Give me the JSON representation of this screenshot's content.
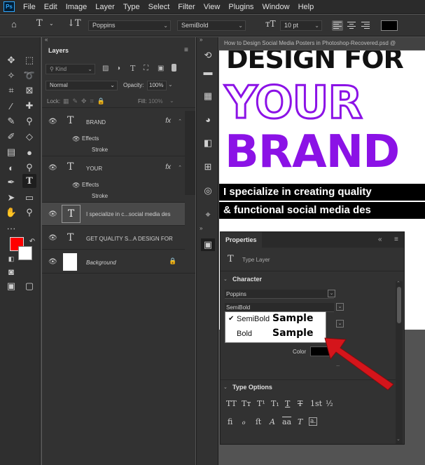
{
  "menu": [
    "File",
    "Edit",
    "Image",
    "Layer",
    "Type",
    "Select",
    "Filter",
    "View",
    "Plugins",
    "Window",
    "Help"
  ],
  "options": {
    "font_family": "Poppins",
    "font_style": "SemiBold",
    "font_size": "10 pt"
  },
  "layers_panel": {
    "title": "Layers",
    "filter_placeholder": "Kind",
    "blend_mode": "Normal",
    "opacity_label": "Opacity:",
    "opacity_value": "100%",
    "lock_label": "Lock:",
    "fill_label": "Fill:",
    "fill_value": "100%",
    "layers": [
      {
        "name": "BRAND",
        "fx": "fx",
        "effects": "Effects",
        "stroke": "Stroke"
      },
      {
        "name": "YOUR",
        "fx": "fx",
        "effects": "Effects",
        "stroke": "Stroke"
      },
      {
        "name": "I specialize in c...social media des"
      },
      {
        "name": "GET QUALITY  S...A DESIGN FOR"
      },
      {
        "name": "Background"
      }
    ]
  },
  "document": {
    "tab_title": "How to Design Social Media Posters in Photoshop-Recovered.psd @",
    "line1": "DESIGN FOR",
    "line2": "YOUR",
    "line3": "BRAND",
    "line4": "I specialize in creating quality",
    "line5": "& functional social media des",
    "brand_color": "#8b12e6"
  },
  "properties": {
    "title": "Properties",
    "layer_type": "Type Layer",
    "character_header": "Character",
    "font_family": "Poppins",
    "font_style": "SemiBold",
    "color_label": "Color",
    "type_options_header": "Type Options"
  },
  "popup": {
    "items": [
      {
        "check": "✔",
        "label": "SemiBold",
        "sample": "Sample"
      },
      {
        "check": "",
        "label": "Bold",
        "sample": "Sample"
      }
    ]
  },
  "colors": {
    "foreground": "#ff0000",
    "background": "#ffffff",
    "arrow": "#d4151b"
  }
}
